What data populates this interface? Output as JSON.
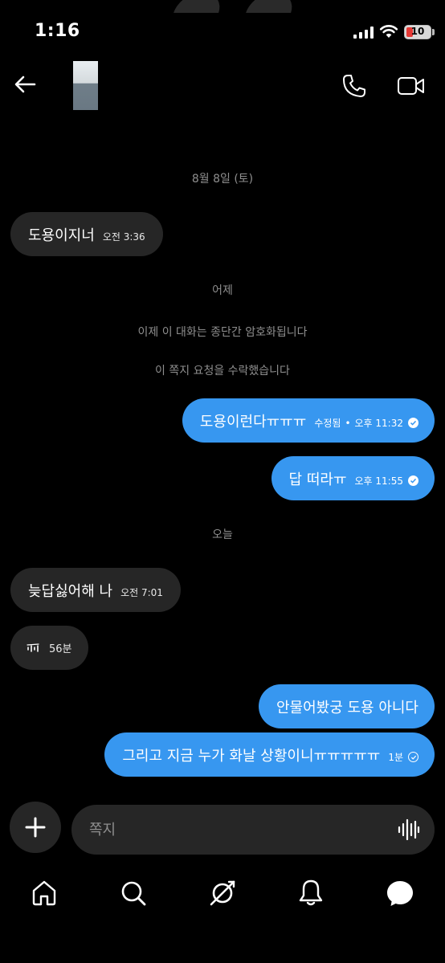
{
  "status_bar": {
    "time": "1:16",
    "battery": "10"
  },
  "header": {
    "back_label": "back",
    "icons": [
      "back-arrow-icon",
      "phone-icon",
      "video-camera-icon"
    ]
  },
  "messages": [
    {
      "kind": "date",
      "text": "8월 8일 (토)"
    },
    {
      "kind": "in",
      "text": "도용이지너",
      "time": "오전 3:36"
    },
    {
      "kind": "date",
      "text": "어제"
    },
    {
      "kind": "system",
      "text": "이제 이 대화는 종단간 암호화됩니다"
    },
    {
      "kind": "system",
      "text": "이 쪽지 요청을 수락했습니다"
    },
    {
      "kind": "out",
      "text": "도용이런다ㅠㅠㅠ",
      "edited": "수정됨",
      "time": "오후 11:32"
    },
    {
      "kind": "out",
      "text": "답 떠라ㅠ",
      "time": "오후 11:55"
    },
    {
      "kind": "date",
      "text": "오늘"
    },
    {
      "kind": "in",
      "text": "늦답싫어해 나",
      "time": "오전 7:01"
    },
    {
      "kind": "in-voice",
      "duration": "56분"
    },
    {
      "kind": "out",
      "text": "안물어봤궁 도용 아니다"
    },
    {
      "kind": "out",
      "text": "그리고 지금 누가 화날 상황이니ㅠㅠㅠㅠㅠ",
      "time": "1분"
    }
  ],
  "composer": {
    "placeholder": "쪽지"
  },
  "tabbar": {
    "items": [
      "home-icon",
      "search-icon",
      "explore-icon",
      "notifications-icon",
      "messages-icon"
    ]
  },
  "colors": {
    "background": "#000000",
    "bubble_in": "#262626",
    "bubble_out": "#3797f0",
    "meta_text": "#8e8e8e"
  }
}
